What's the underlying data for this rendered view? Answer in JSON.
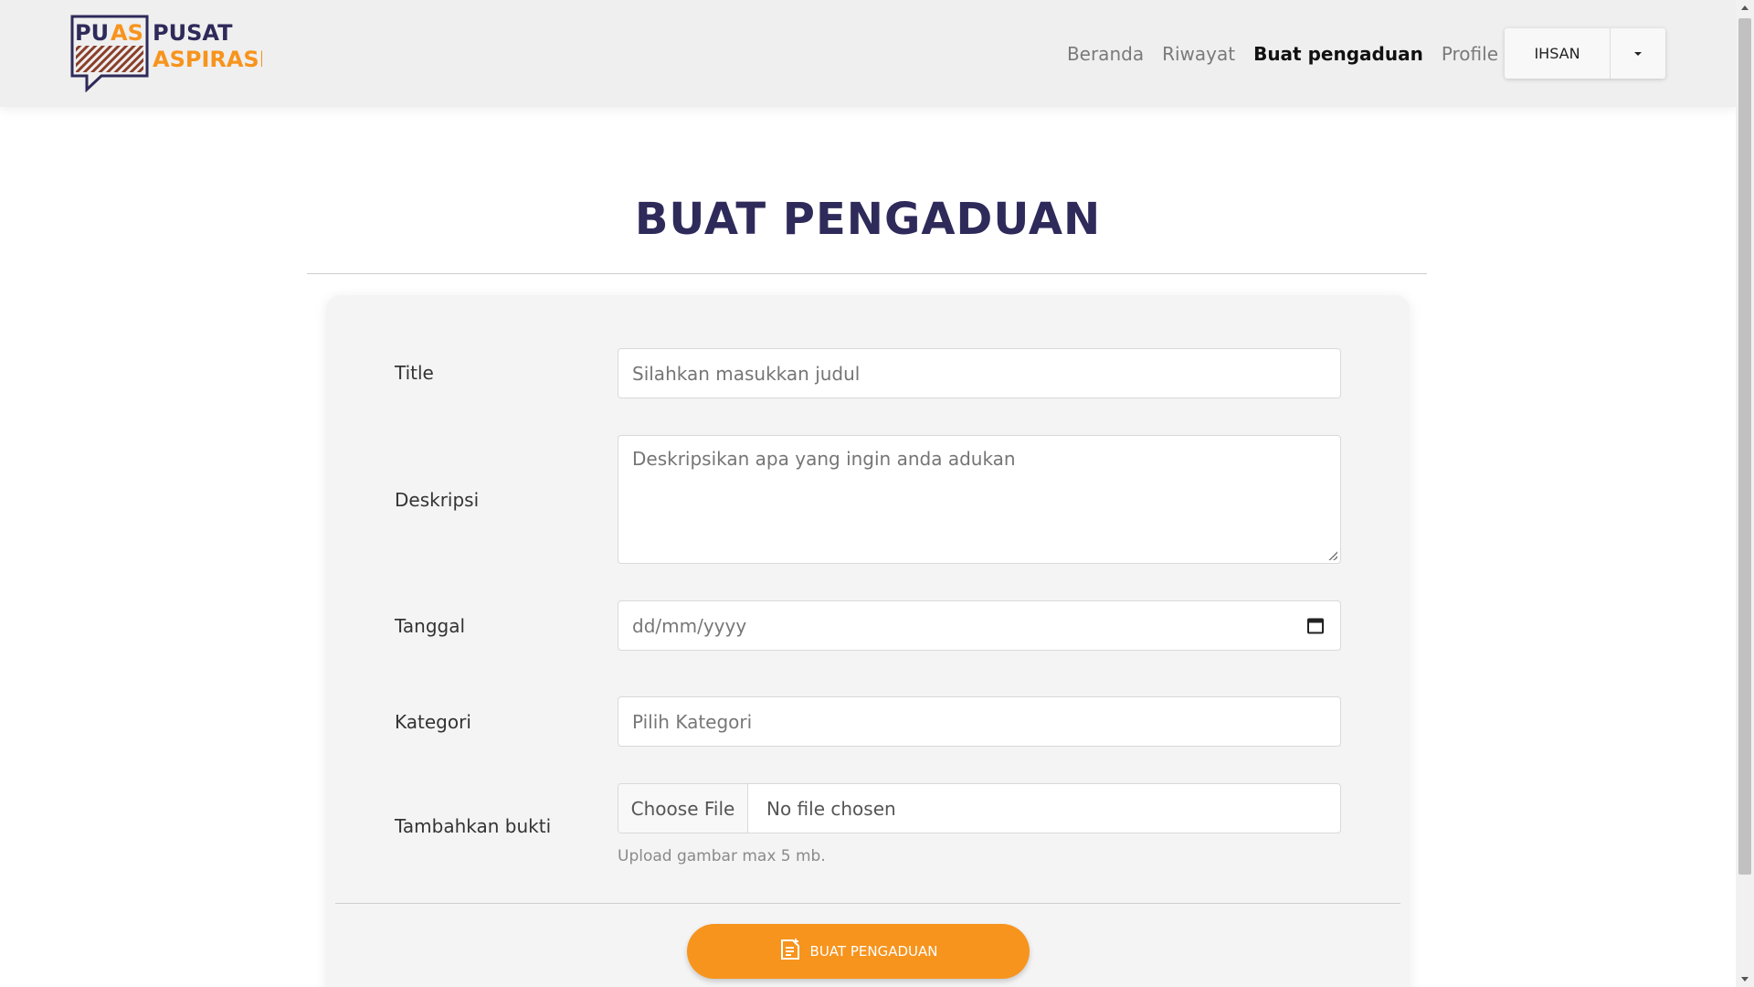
{
  "brand": {
    "logo_text_left": "PUAS",
    "logo_text_pusat": "PUSAT",
    "logo_text_aspirasi": "ASPIRASI",
    "colors": {
      "primary": "#2e2a5a",
      "accent": "#f7941d"
    }
  },
  "nav": {
    "items": [
      {
        "label": "Beranda"
      },
      {
        "label": "Riwayat"
      },
      {
        "label": "Buat pengaduan",
        "active": true
      },
      {
        "label": "Profile"
      }
    ],
    "user_label": "IHSAN"
  },
  "page": {
    "title": "BUAT PENGADUAN"
  },
  "form": {
    "title_label": "Title",
    "title_placeholder": "Silahkan masukkan judul",
    "description_label": "Deskripsi",
    "description_placeholder": "Deskripsikan apa yang ingin anda adukan",
    "date_label": "Tanggal",
    "date_placeholder": "dd/mm/yyyy",
    "category_label": "Kategori",
    "category_placeholder": "Pilih Kategori",
    "evidence_label": "Tambahkan bukti",
    "file_button": "Choose File",
    "file_status": "No file chosen",
    "help_text": "Upload gambar max 5 mb.",
    "submit_label": "BUAT PENGADUAN"
  }
}
